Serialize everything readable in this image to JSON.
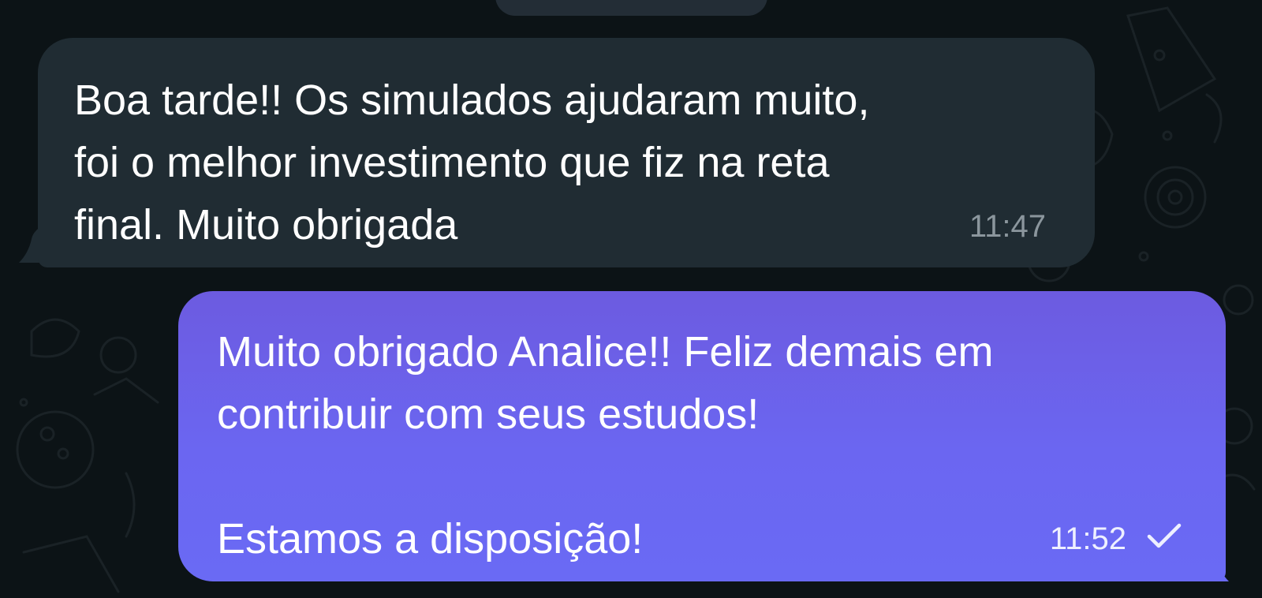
{
  "theme": {
    "background": "#0c1316",
    "incoming_bubble": "#202c33",
    "outgoing_bubble": "#6b66f1",
    "timestamp_incoming": "#8b969d",
    "timestamp_outgoing": "#eef0ff"
  },
  "messages": [
    {
      "direction": "incoming",
      "text": "Boa tarde!! Os simulados ajudaram muito,\nfoi o melhor investimento que fiz na reta\nfinal. Muito obrigada",
      "time": "11:47"
    },
    {
      "direction": "outgoing",
      "text": "Muito obrigado Analice!! Feliz demais em\ncontribuir com seus estudos!\n\nEstamos a disposição!",
      "time": "11:52",
      "status_icon": "check-icon"
    }
  ]
}
